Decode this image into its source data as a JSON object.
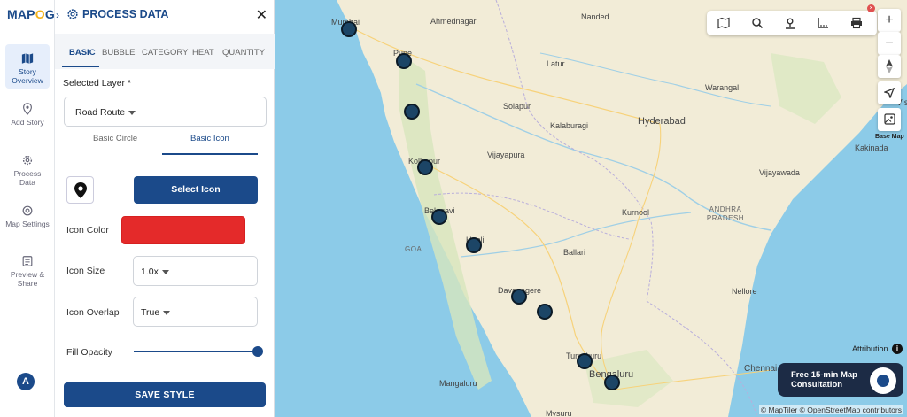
{
  "app": {
    "logo_prefix": "MAP",
    "logo_o": "O",
    "logo_suffix": "G"
  },
  "rail": {
    "items": [
      {
        "label": "Story Overview",
        "icon": "map-icon",
        "active": true
      },
      {
        "label": "Add Story",
        "icon": "pin-icon"
      },
      {
        "label": "Process Data",
        "icon": "gear-icon"
      },
      {
        "label": "Map Settings",
        "icon": "settings-icon"
      },
      {
        "label": "Preview & Share",
        "icon": "share-icon"
      }
    ],
    "avatar": "A"
  },
  "panel": {
    "title": "PROCESS DATA",
    "tabs": [
      "BASIC",
      "BUBBLE",
      "CATEGORY",
      "HEAT",
      "QUANTITY"
    ],
    "active_tab": "BASIC",
    "selected_layer_label": "Selected Layer *",
    "selected_layer_value": "Road Route",
    "subtabs": [
      "Basic Circle",
      "Basic Icon"
    ],
    "active_subtab": "Basic Icon",
    "select_icon_label": "Select Icon",
    "icon_color_label": "Icon Color",
    "icon_color_value": "#e42a2a",
    "icon_size_label": "Icon Size",
    "icon_size_value": "1.0x",
    "icon_overlap_label": "Icon Overlap",
    "icon_overlap_value": "True",
    "fill_opacity_label": "Fill Opacity",
    "fill_opacity_value": 1.0,
    "save_label": "SAVE STYLE"
  },
  "map": {
    "cities": [
      "Mumbai",
      "Ahmednagar",
      "Nanded",
      "Pune",
      "Latur",
      "Warangal",
      "Solapur",
      "Kalaburagi",
      "Hyderabad",
      "Vijayapura",
      "Kolhapur",
      "Kakinada",
      "Vijayawada",
      "Belagavi",
      "Kurnool",
      "ANDHRA PRADESH",
      "Hubli",
      "GOA",
      "Ballari",
      "Davanagere",
      "Nellore",
      "Tumakuru",
      "Mangaluru",
      "Bengaluru",
      "Chennai",
      "Mysuru",
      "Vis"
    ],
    "marker_color": "#1c4566",
    "toolbar_icons": [
      "layers-icon",
      "search-icon",
      "location-person-icon",
      "measure-icon",
      "print-icon"
    ],
    "controls": [
      "+",
      "−"
    ],
    "base_map_label": "Base Map",
    "attribution_label": "Attribution",
    "consult_label": "Free 15-min Map Consultation",
    "copyright": "© MapTiler © OpenStreetMap contributors"
  }
}
